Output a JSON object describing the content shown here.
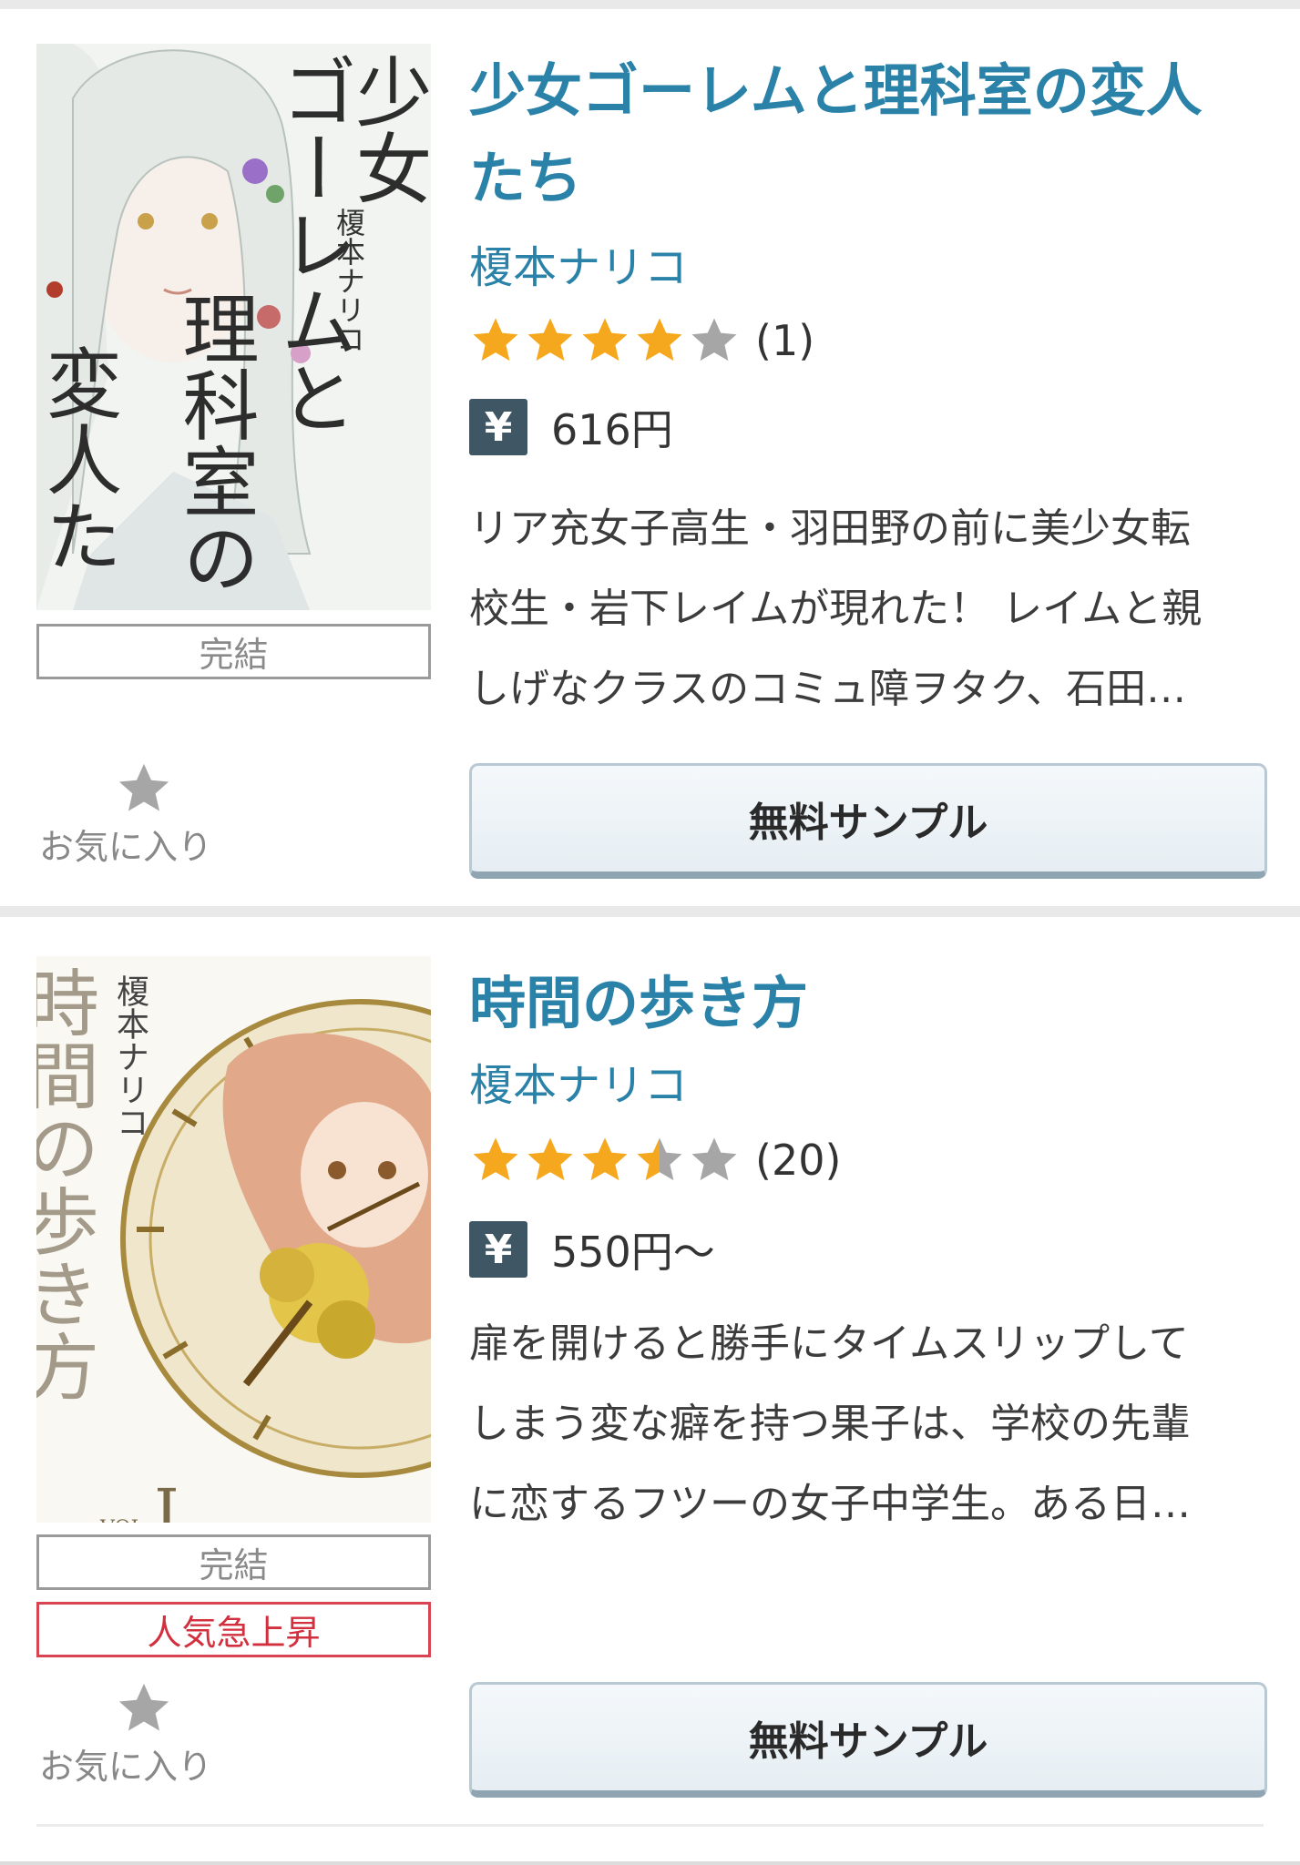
{
  "items": [
    {
      "title": "少女ゴーレムと理科室の変人たち",
      "title_line1": "少女ゴーレムと理科室の変人",
      "title_line2": "たち",
      "author": "榎本ナリコ",
      "rating": 4,
      "rating_count": "(1)",
      "price_icon": "¥",
      "price": "616円",
      "description_lines": [
        "リア充女子高生・羽田野の前に美少女転",
        "校生・岩下レイムが現れた！ レイムと親",
        "しげなクラスのコミュ障ヲタク、石田…"
      ],
      "tags": [
        "完結"
      ],
      "favorite_label": "お気に入り",
      "sample_button": "無料サンプル",
      "cover": {
        "title_chars": "少女ゴーレムと理科室の変人たち",
        "author_chars": "榎本ナリコ"
      }
    },
    {
      "title": "時間の歩き方",
      "author": "榎本ナリコ",
      "rating": 3.5,
      "rating_count": "(20)",
      "price_icon": "¥",
      "price": "550円～",
      "description_lines": [
        "扉を開けると勝手にタイムスリップして",
        "しまう変な癖を持つ果子は、学校の先輩",
        "に恋するフツーの女子中学生。ある日…"
      ],
      "tags": [
        "完結",
        "人気急上昇"
      ],
      "favorite_label": "お気に入り",
      "sample_button": "無料サンプル",
      "cover": {
        "title_chars": "時間の歩き方",
        "author_chars": "榎本ナリコ",
        "volume": "VOL. I"
      }
    }
  ],
  "colors": {
    "link_blue": "#2a82a8",
    "star_gold": "#f5a81d",
    "star_gray": "#a6a6a6",
    "hot_red": "#d22f3f",
    "yen_bg": "#3f5664"
  }
}
